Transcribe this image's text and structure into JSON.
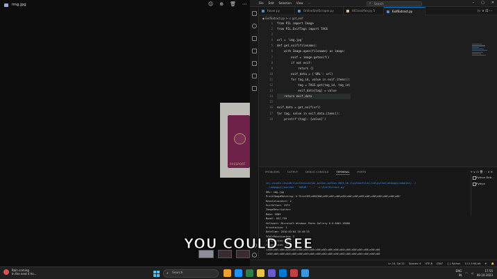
{
  "viewer": {
    "title": "img.jpg",
    "tools": [
      "☺",
      "⊕",
      "🗑",
      "⋯"
    ],
    "passport_text": "PASSPORT"
  },
  "vscode": {
    "menu": [
      "File",
      "Edit",
      "Selection",
      "View",
      "⋯"
    ],
    "search_placeholder": "Search",
    "window_controls": [
      "–",
      "▢",
      "✕"
    ],
    "tabs": [
      {
        "label": "hover.py",
        "color": "#4a8fd6"
      },
      {
        "label": "OnlineSiteScraper.py",
        "color": "#4a8fd6"
      },
      {
        "label": "AIClassifier.py 5",
        "color": "#e2c08d"
      },
      {
        "label": "ExifExtract.py",
        "color": "#4a8fd6"
      }
    ],
    "breadcrumb": "◆ ExifExtract.py > ⊙ get_exif",
    "code_lines": [
      "from PIL import Image",
      "from PIL.ExifTags import TAGS",
      "",
      "url = 'img.jpg'",
      "def get_exif(filename):",
      "    with Image.open(filename) as image:",
      "        exif = image.getexif()",
      "        if not exif:",
      "            return {}",
      "        exif_data = {'URL': url}",
      "        for tag_id, value in exif.items():",
      "            tag = TAGS.get(tag_id, tag_id)",
      "            exif_data[tag] = value",
      "    return exif_data",
      "",
      "exif_data = get_exif(url)",
      "for tag, value in exif_data.items():",
      "    print(f'{tag}: {value}')"
    ],
    "panel_tabs": [
      "PROBLEMS",
      "OUTPUT",
      "DEBUG CONSOLE",
      "TERMINAL",
      "PORTS"
    ],
    "panel_right": "+ ∨ ⊡ 🗑 ⋯ ∧ ✕",
    "terminal_lines": [
      "in\\.vscode-insiders\\extensions\\ms-python.python-2023.16.1\\pythonFiles\\lib\\python\\debugpy\\adapter/../",
      "..\\debugpy\\launcher' '50546' '--' 'c:\\ExifExtract.py'",
      "URL: img.jpg",
      "PrintImageMatching: b'PrintIM\\x000300\\x00\\x00\\x00\\x00\\x00\\x00\\x00\\x00\\x00\\x00\\x00\\x00\\x00'",
      "ResolutionUnit: 2",
      "ExifOffset: 2372",
      "ImageDescription:",
      "Make: SONY",
      "Model: DSC-T99",
      "Software: Microsoft Windows Photo Gallery 6.0.6001.18000",
      "Orientation: 1",
      "DateTime: 2010:03:04 16:40:35",
      "YCbCrPositioning: 2",
      "XResolution: 72.0",
      "YResolution: 72.0",
      "\\x00\\x00\\x00\\x00\\x00\\x00\\x00\\x00\\x00\\x00\\x00\\x00\\x00\\x00\\x00\\x00\\x00\\x00\\x00",
      "\\x00\\x00\\x00\\x00\\x00\\x00\\x00\\x00\\x00\\x00\\x00\\x00\\x00\\x00\\x00\\x00\\x00\\x00\\x00"
    ],
    "terminal_sessions": [
      "Python Deb...",
      "Python"
    ],
    "status_items": [
      "Ln 14, Col 21",
      "Spaces: 4",
      "UTF-8",
      "CRLF",
      "{ } Python",
      "3.11.5 64-bit",
      "⊕",
      "🔔"
    ]
  },
  "caption": "YOU COULD SEE",
  "taskbar": {
    "weather_line1": "Rain coming",
    "weather_line2": "In the next 4 ho...",
    "search_placeholder": "Search",
    "tray_lang_1": "ENG",
    "tray_lang_2": "IN",
    "time": "17:55",
    "date": "08-10-2023",
    "app_colors": [
      "#f0a030",
      "#1e90ff",
      "#2d7d46",
      "#e8c14a",
      "#6a5acd",
      "#0078d4",
      "#c24141",
      "#3a96dd"
    ]
  }
}
